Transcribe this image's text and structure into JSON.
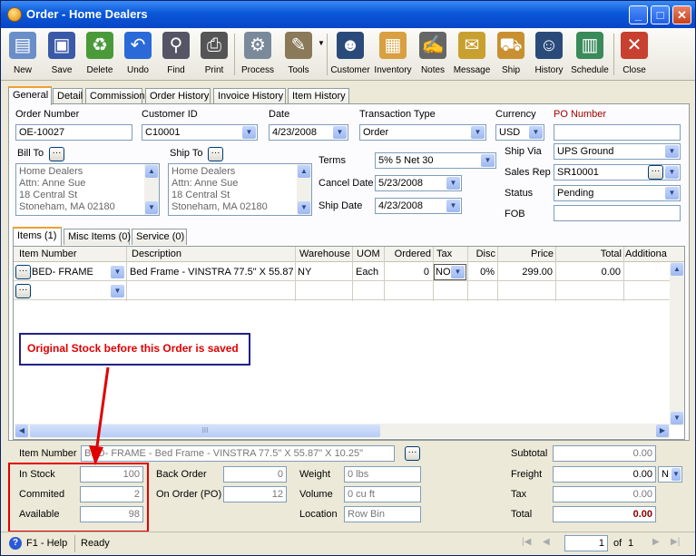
{
  "window": {
    "title": "Order - Home Dealers",
    "min": "_",
    "max": "□",
    "close": "✕"
  },
  "toolbar": [
    "New",
    "Save",
    "Delete",
    "Undo",
    "Find",
    "Print",
    "Process",
    "Tools",
    "Customer",
    "Inventory",
    "Notes",
    "Message",
    "Ship",
    "History",
    "Schedule",
    "Close"
  ],
  "tabs": [
    "General",
    "Detail",
    "Commission",
    "Order History",
    "Invoice History",
    "Item History"
  ],
  "form": {
    "order_number_label": "Order Number",
    "order_number": "OE-10027",
    "customer_id_label": "Customer ID",
    "customer_id": "C10001",
    "date_label": "Date",
    "date": "4/23/2008",
    "transaction_type_label": "Transaction Type",
    "transaction_type": "Order",
    "currency_label": "Currency",
    "currency": "USD",
    "po_number_label": "PO Number",
    "po_number": "",
    "bill_to_label": "Bill To",
    "bill_to": [
      "Home Dealers",
      "Attn: Anne Sue",
      "18 Central St",
      "Stoneham, MA 02180"
    ],
    "ship_to_label": "Ship To",
    "ship_to": [
      "Home Dealers",
      "Attn: Anne Sue",
      "18 Central St",
      "Stoneham, MA 02180"
    ],
    "terms_label": "Terms",
    "terms": "5% 5 Net 30",
    "cancel_date_label": "Cancel Date",
    "cancel_date": "5/23/2008",
    "ship_date_label": "Ship Date",
    "ship_date": "4/23/2008",
    "ship_via_label": "Ship Via",
    "ship_via": "UPS Ground",
    "sales_rep_label": "Sales Rep",
    "sales_rep": "SR10001",
    "status_label": "Status",
    "status": "Pending",
    "fob_label": "FOB",
    "fob": ""
  },
  "items_tabs": [
    "Items (1)",
    "Misc Items (0)",
    "Service (0)"
  ],
  "grid": {
    "columns": [
      "Item Number",
      "Description",
      "Warehouse",
      "UOM",
      "Ordered",
      "Tax",
      "Disc",
      "Price",
      "Total",
      "Additiona"
    ],
    "rows": [
      {
        "item": "BED- FRAME",
        "description": "Bed Frame - VINSTRA 77.5\" X 55.87\"",
        "warehouse": "NY",
        "uom": "Each",
        "ordered": "0",
        "tax": "NON",
        "disc": "0%",
        "price": "299.00",
        "total": "0.00"
      }
    ],
    "hscroll_thumb": "III"
  },
  "annotation": "Original Stock before this Order is saved",
  "bottom": {
    "item_number_label": "Item Number",
    "item_number": "BED- FRAME - Bed Frame - VINSTRA 77.5\" X 55.87\" X 10.25\"",
    "in_stock_label": "In Stock",
    "in_stock": "100",
    "committed_label": "Commited",
    "committed": "2",
    "available_label": "Available",
    "available": "98",
    "back_order_label": "Back Order",
    "back_order": "0",
    "on_order_label": "On Order (PO)",
    "on_order": "12",
    "weight_label": "Weight",
    "weight": "0 lbs",
    "volume_label": "Volume",
    "volume": "0 cu ft",
    "location_label": "Location",
    "location": "Row Bin",
    "subtotal_label": "Subtotal",
    "subtotal": "0.00",
    "freight_label": "Freight",
    "freight": "0.00",
    "freight_code": "N",
    "tax_label": "Tax",
    "tax": "0.00",
    "total_label": "Total",
    "total": "0.00"
  },
  "status": {
    "help": "F1 - Help",
    "text": "Ready",
    "page": "1",
    "of": "of",
    "pages": "1"
  }
}
